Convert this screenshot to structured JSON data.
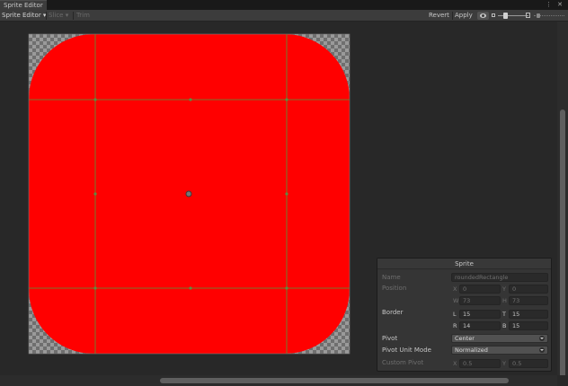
{
  "window": {
    "tab_title": "Sprite Editor",
    "menu_glyph": "⋮",
    "close_glyph": "✕"
  },
  "toolbar": {
    "mode_label": "Sprite Editor ▾",
    "slice_label": "Slice ▾",
    "trim_label": "Trim",
    "revert_label": "Revert",
    "apply_label": "Apply"
  },
  "icons": {
    "channel_toggle": "eye-icon",
    "zoom_small": "small-mountain-icon",
    "zoom_large": "large-mountain-icon"
  },
  "colors": {
    "sprite_fill": "#ff0000",
    "border_lines": "#4e9a3a",
    "panel_bg": "#353535"
  },
  "sprite_panel": {
    "title": "Sprite",
    "name_label": "Name",
    "name_value": "roundedRectangle",
    "position_label": "Position",
    "pos_x_axis": "X",
    "pos_x_value": "0",
    "pos_y_axis": "Y",
    "pos_y_value": "0",
    "pos_w_axis": "W",
    "pos_w_value": "73",
    "pos_h_axis": "H",
    "pos_h_value": "73",
    "border_label": "Border",
    "border_l_axis": "L",
    "border_l_value": "15",
    "border_t_axis": "T",
    "border_t_value": "15",
    "border_r_axis": "R",
    "border_r_value": "14",
    "border_b_axis": "B",
    "border_b_value": "15",
    "pivot_label": "Pivot",
    "pivot_value": "Center",
    "pivot_unit_label": "Pivot Unit Mode",
    "pivot_unit_value": "Normalized",
    "custom_pivot_label": "Custom Pivot",
    "custom_x_axis": "X",
    "custom_x_value": "0.5",
    "custom_y_axis": "Y",
    "custom_y_value": "0.5"
  },
  "scroll": {
    "vertical_fraction": 0.76,
    "horizontal_fraction": 0.63
  }
}
